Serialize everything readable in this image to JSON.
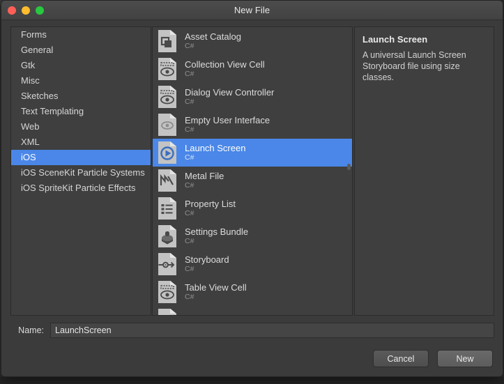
{
  "window": {
    "title": "New File",
    "traffic_lights": [
      "close-button",
      "minimize-button",
      "maximize-button"
    ]
  },
  "categories": {
    "items": [
      {
        "label": "Forms",
        "selected": false
      },
      {
        "label": "General",
        "selected": false
      },
      {
        "label": "Gtk",
        "selected": false
      },
      {
        "label": "Misc",
        "selected": false
      },
      {
        "label": "Sketches",
        "selected": false
      },
      {
        "label": "Text Templating",
        "selected": false
      },
      {
        "label": "Web",
        "selected": false
      },
      {
        "label": "XML",
        "selected": false
      },
      {
        "label": "iOS",
        "selected": true
      },
      {
        "label": "iOS SceneKit Particle Systems",
        "selected": false
      },
      {
        "label": "iOS SpriteKit Particle Effects",
        "selected": false
      }
    ]
  },
  "templates": {
    "items": [
      {
        "name": "Asset Catalog",
        "lang": "C#",
        "icon": "asset-catalog-icon",
        "selected": false
      },
      {
        "name": "Collection View Cell",
        "lang": "C#",
        "icon": "view-cell-icon",
        "selected": false
      },
      {
        "name": "Dialog View Controller",
        "lang": "C#",
        "icon": "view-cell-icon",
        "selected": false
      },
      {
        "name": "Empty User Interface",
        "lang": "C#",
        "icon": "empty-interface-icon",
        "selected": false
      },
      {
        "name": "Launch Screen",
        "lang": "C#",
        "icon": "launch-screen-icon",
        "selected": true
      },
      {
        "name": "Metal File",
        "lang": "C#",
        "icon": "metal-file-icon",
        "selected": false
      },
      {
        "name": "Property List",
        "lang": "C#",
        "icon": "property-list-icon",
        "selected": false
      },
      {
        "name": "Settings Bundle",
        "lang": "C#",
        "icon": "settings-bundle-icon",
        "selected": false
      },
      {
        "name": "Storyboard",
        "lang": "C#",
        "icon": "storyboard-icon",
        "selected": false
      },
      {
        "name": "Table View Cell",
        "lang": "C#",
        "icon": "view-cell-icon",
        "selected": false
      }
    ]
  },
  "description": {
    "title": "Launch Screen",
    "body": "A universal Launch Screen Storyboard file using size classes."
  },
  "name_field": {
    "label": "Name:",
    "value": "LaunchScreen",
    "placeholder": ""
  },
  "buttons": {
    "cancel": "Cancel",
    "new": "New"
  },
  "colors": {
    "accent": "#4a87e8",
    "panel": "#3f3f3f",
    "dialog": "#3b3b3b",
    "titlebar": "#4c4c4c",
    "text": "#dcdcdc",
    "subtext": "#8f8f8f"
  }
}
